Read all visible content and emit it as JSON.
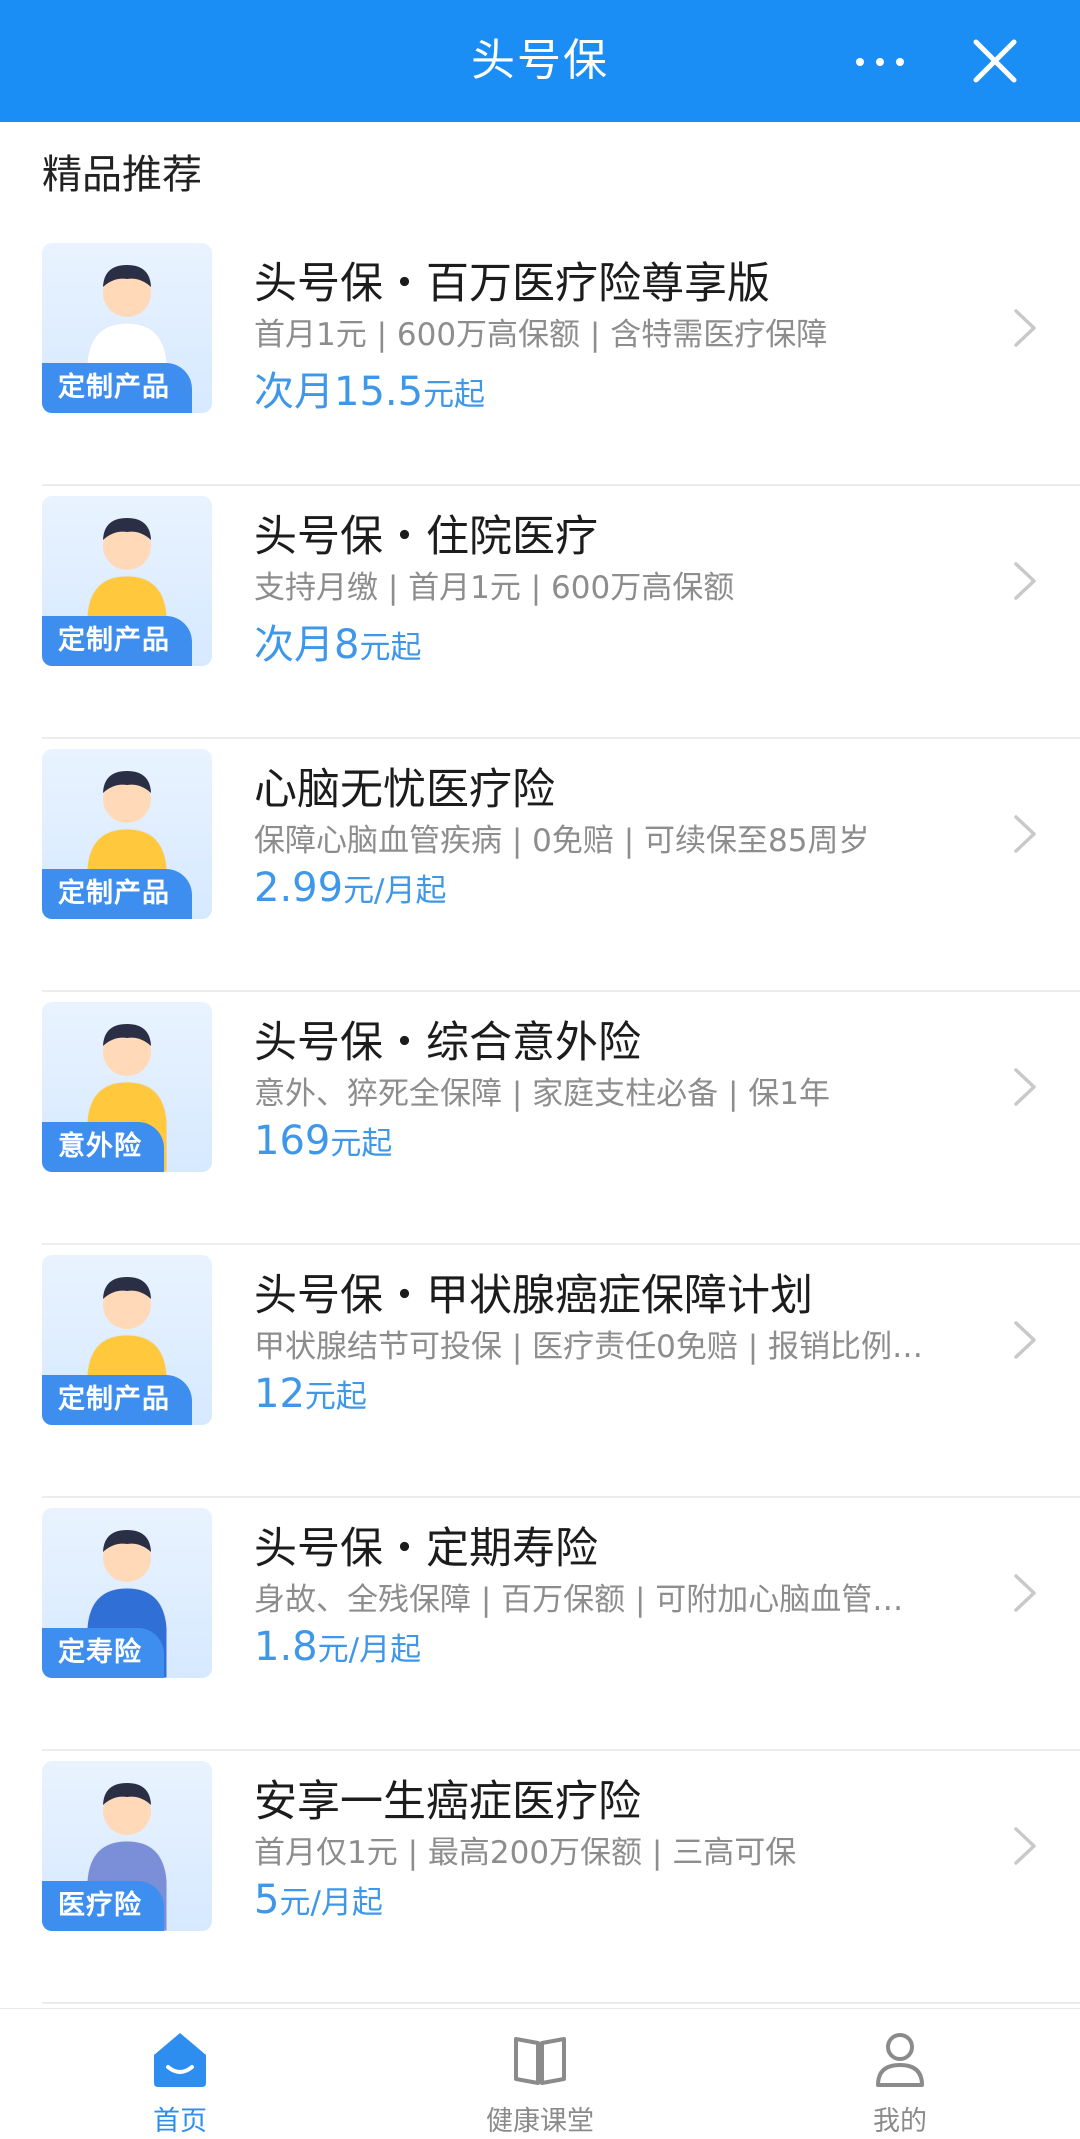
{
  "header": {
    "title": "头号保",
    "more_icon": "more-icon",
    "close_icon": "close-icon"
  },
  "section": {
    "title": "精品推荐"
  },
  "products": [
    {
      "name": "头号保・百万医疗险尊享版",
      "desc": "首月1元 | 600万高保额 | 含特需医疗保障",
      "price_prefix": "次月",
      "price_num": "15.5",
      "price_unit": "元起",
      "badge": "定制产品"
    },
    {
      "name": "头号保・住院医疗",
      "desc": "支持月缴 | 首月1元 | 600万高保额",
      "price_prefix": "次月",
      "price_num": "8",
      "price_unit": "元起",
      "badge": "定制产品"
    },
    {
      "name": "心脑无忧医疗险",
      "desc": "保障心脑血管疾病 | 0免赔 | 可续保至85周岁",
      "price_prefix": "",
      "price_num": "2.99",
      "price_unit": "元/月起",
      "badge": "定制产品"
    },
    {
      "name": "头号保・综合意外险",
      "desc": "意外、猝死全保障 | 家庭支柱必备 | 保1年",
      "price_prefix": "",
      "price_num": "169",
      "price_unit": "元起",
      "badge": "意外险"
    },
    {
      "name": "头号保・甲状腺癌症保障计划",
      "desc": "甲状腺结节可投保 | 医疗责任0免赔 | 报销比例…",
      "price_prefix": "",
      "price_num": "12",
      "price_unit": "元起",
      "badge": "定制产品"
    },
    {
      "name": "头号保・定期寿险",
      "desc": "身故、全残保障 | 百万保额 | 可附加心脑血管…",
      "price_prefix": "",
      "price_num": "1.8",
      "price_unit": "元/月起",
      "badge": "定寿险"
    },
    {
      "name": "安享一生癌症医疗险",
      "desc": "首月仅1元 | 最高200万保额 | 三高可保",
      "price_prefix": "",
      "price_num": "5",
      "price_unit": "元/月起",
      "badge": "医疗险"
    }
  ],
  "tabbar": {
    "tabs": [
      {
        "label": "首页",
        "icon": "home-icon",
        "active": true
      },
      {
        "label": "健康课堂",
        "icon": "book-icon",
        "active": false
      },
      {
        "label": "我的",
        "icon": "user-icon",
        "active": false
      }
    ]
  },
  "colors": {
    "header_bg": "#1a8ef5",
    "accent": "#3e97e8",
    "badge_bg": "#3e8ef0"
  }
}
